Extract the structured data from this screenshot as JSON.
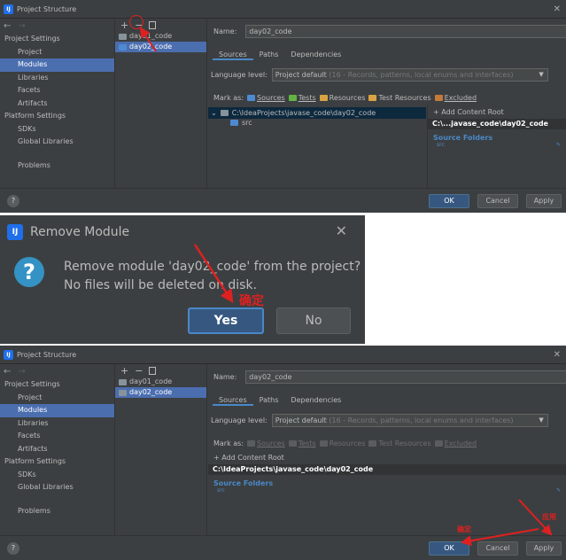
{
  "window": {
    "title": "Project Structure",
    "close": "✕"
  },
  "sidebar": {
    "group_project": "Project Settings",
    "items_project": [
      "Project",
      "Modules",
      "Libraries",
      "Facets",
      "Artifacts"
    ],
    "group_platform": "Platform Settings",
    "items_platform": [
      "SDKs",
      "Global Libraries"
    ],
    "problems": "Problems",
    "selected": "Modules"
  },
  "modules_toolbar": {
    "add": "+",
    "remove": "−"
  },
  "modules": [
    "day01_code",
    "day02_code"
  ],
  "content": {
    "name_label": "Name:",
    "name_value": "day02_code",
    "tabs": [
      "Sources",
      "Paths",
      "Dependencies"
    ],
    "language_label": "Language level:",
    "language_value": "Project default",
    "language_hint": "(16 - Records, patterns, local enums and interfaces)",
    "mark_as_label": "Mark as:",
    "mark_as": [
      "Sources",
      "Tests",
      "Resources",
      "Test Resources",
      "Excluded"
    ],
    "tree_root": "C:\\IdeaProjects\\javase_code\\day02_code",
    "tree_child": "src",
    "add_content_root": "+ Add Content Root",
    "root_short": "C:\\...javase_code\\day02_code",
    "root_full": "C:\\IdeaProjects\\javase_code\\day02_code",
    "source_folders": "Source Folders",
    "source_item": "src"
  },
  "buttons": {
    "help": "?",
    "ok": "OK",
    "cancel": "Cancel",
    "apply": "Apply"
  },
  "dialog": {
    "title": "Remove Module",
    "line1": "Remove module 'day02_code' from the project?",
    "line2": "No files will be deleted on disk.",
    "yes": "Yes",
    "no": "No",
    "icon": "?",
    "close": "✕"
  },
  "annotations": {
    "confirm": "确定",
    "apply": "应用"
  },
  "colors": {
    "accent": "#4b6eaf",
    "annotation": "#e02020",
    "panel": "#3c3f41"
  }
}
